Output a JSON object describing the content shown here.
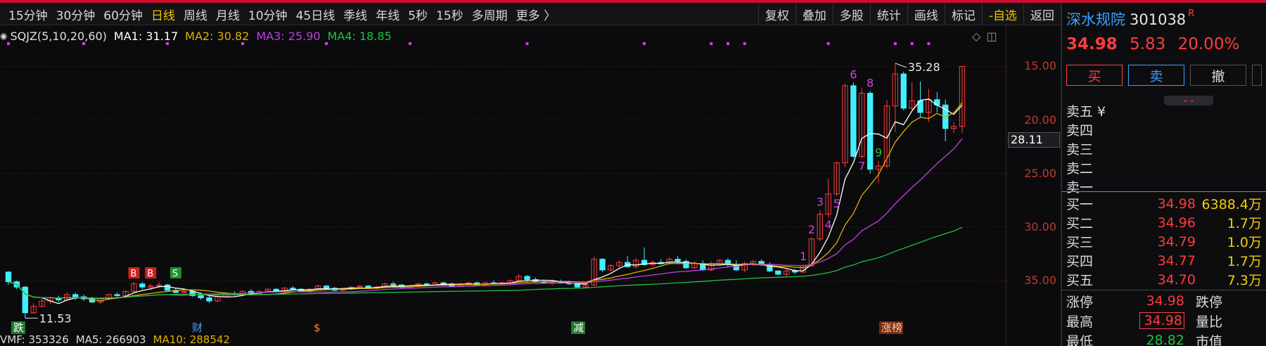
{
  "toolbar": {
    "periods": [
      {
        "label": "15分钟",
        "active": false
      },
      {
        "label": "30分钟",
        "active": false
      },
      {
        "label": "60分钟",
        "active": false
      },
      {
        "label": "日线",
        "active": true
      },
      {
        "label": "周线",
        "active": false
      },
      {
        "label": "月线",
        "active": false
      },
      {
        "label": "10分钟",
        "active": false
      },
      {
        "label": "45日线",
        "active": false
      },
      {
        "label": "季线",
        "active": false
      },
      {
        "label": "年线",
        "active": false
      },
      {
        "label": "5秒",
        "active": false
      },
      {
        "label": "15秒",
        "active": false
      },
      {
        "label": "多周期",
        "active": false
      },
      {
        "label": "更多 〉",
        "active": false
      }
    ],
    "actions": [
      {
        "label": "复权",
        "highlight": false
      },
      {
        "label": "叠加",
        "highlight": false
      },
      {
        "label": "多股",
        "highlight": false
      },
      {
        "label": "统计",
        "highlight": false
      },
      {
        "label": "画线",
        "highlight": false
      },
      {
        "label": "标记",
        "highlight": false
      },
      {
        "label": "-自选",
        "highlight": true
      },
      {
        "label": "返回",
        "highlight": false
      }
    ]
  },
  "legend": {
    "indicator": "SQJZ(5,10,20,60)",
    "ma1": "MA1: 31.17",
    "ma2": "MA2: 30.82",
    "ma3": "MA3: 25.90",
    "ma4": "MA4: 18.85"
  },
  "colors": {
    "up": "#ff3b3b",
    "down": "#3ff0ff",
    "ma1": "#ffffff",
    "ma2": "#e0b000",
    "ma3": "#c040e0",
    "ma4": "#20c040"
  },
  "axis": {
    "ticks": [
      "35.00",
      "30.00",
      "25.00",
      "20.00",
      "15.00"
    ],
    "current": "28.11"
  },
  "chart_data": {
    "type": "candlestick",
    "ylim": [
      11,
      37
    ],
    "y_ticks": [
      15,
      20,
      25,
      30,
      35
    ],
    "annotations": {
      "high_label": "35.28",
      "low_label": "11.53",
      "counts": [
        "1",
        "2",
        "3",
        "4",
        "5",
        "6",
        "7",
        "8",
        "9"
      ],
      "signals": [
        "B",
        "B",
        "S"
      ],
      "events": [
        "跌",
        "财",
        "$",
        "减",
        "涨榜"
      ]
    },
    "ohlc": [
      [
        15.8,
        15.9,
        14.6,
        14.9
      ],
      [
        14.9,
        15.0,
        14.2,
        14.4
      ],
      [
        14.4,
        14.5,
        11.5,
        12.0
      ],
      [
        12.0,
        12.9,
        11.9,
        12.6
      ],
      [
        12.6,
        13.3,
        12.5,
        13.1
      ],
      [
        13.1,
        13.5,
        12.8,
        13.4
      ],
      [
        13.4,
        13.6,
        13.0,
        13.2
      ],
      [
        13.2,
        13.9,
        13.1,
        13.7
      ],
      [
        13.7,
        13.9,
        13.2,
        13.5
      ],
      [
        13.5,
        13.7,
        13.1,
        13.3
      ],
      [
        13.3,
        13.5,
        12.9,
        13.0
      ],
      [
        13.0,
        13.4,
        12.8,
        13.3
      ],
      [
        13.3,
        13.8,
        13.2,
        13.7
      ],
      [
        13.7,
        13.9,
        13.4,
        13.6
      ],
      [
        13.6,
        14.1,
        13.5,
        14.0
      ],
      [
        14.0,
        14.9,
        13.9,
        14.7
      ],
      [
        14.7,
        14.9,
        14.2,
        14.4
      ],
      [
        14.4,
        14.7,
        14.1,
        14.5
      ],
      [
        14.5,
        14.9,
        14.3,
        14.6
      ],
      [
        14.6,
        14.7,
        14.0,
        14.1
      ],
      [
        14.1,
        14.3,
        13.8,
        13.9
      ],
      [
        13.9,
        14.2,
        13.7,
        14.0
      ],
      [
        14.0,
        14.1,
        13.5,
        13.6
      ],
      [
        13.6,
        13.9,
        13.2,
        13.4
      ],
      [
        13.4,
        13.6,
        12.9,
        13.1
      ],
      [
        13.1,
        13.6,
        13.0,
        13.5
      ],
      [
        13.5,
        13.9,
        13.4,
        13.8
      ],
      [
        13.8,
        14.0,
        13.6,
        13.7
      ],
      [
        13.7,
        14.1,
        13.6,
        14.0
      ],
      [
        14.0,
        14.2,
        13.7,
        13.8
      ],
      [
        13.8,
        14.1,
        13.7,
        14.0
      ],
      [
        14.0,
        14.3,
        13.9,
        14.2
      ],
      [
        14.2,
        14.3,
        13.9,
        14.0
      ],
      [
        14.0,
        14.4,
        13.9,
        14.3
      ],
      [
        14.3,
        14.5,
        14.1,
        14.2
      ],
      [
        14.2,
        14.3,
        13.9,
        14.0
      ],
      [
        14.0,
        14.3,
        13.9,
        14.2
      ],
      [
        14.2,
        14.6,
        14.1,
        14.5
      ],
      [
        14.5,
        14.6,
        14.2,
        14.3
      ],
      [
        14.3,
        14.4,
        14.0,
        14.1
      ],
      [
        14.1,
        14.3,
        14.0,
        14.2
      ],
      [
        14.2,
        14.5,
        14.1,
        14.4
      ],
      [
        14.4,
        14.6,
        14.3,
        14.5
      ],
      [
        14.5,
        14.6,
        14.2,
        14.3
      ],
      [
        14.3,
        14.5,
        14.2,
        14.4
      ],
      [
        14.4,
        14.8,
        14.3,
        14.7
      ],
      [
        14.7,
        14.9,
        14.5,
        14.6
      ],
      [
        14.6,
        14.7,
        14.3,
        14.4
      ],
      [
        14.4,
        14.6,
        14.3,
        14.5
      ],
      [
        14.5,
        14.8,
        14.4,
        14.7
      ],
      [
        14.7,
        14.8,
        14.5,
        14.6
      ],
      [
        14.6,
        14.9,
        14.5,
        14.8
      ],
      [
        14.8,
        14.9,
        14.6,
        14.7
      ],
      [
        14.7,
        14.8,
        14.4,
        14.5
      ],
      [
        14.5,
        14.8,
        14.4,
        14.7
      ],
      [
        14.7,
        14.9,
        14.6,
        14.8
      ],
      [
        14.8,
        14.9,
        14.5,
        14.6
      ],
      [
        14.6,
        14.9,
        14.5,
        14.8
      ],
      [
        14.8,
        15.0,
        14.6,
        14.7
      ],
      [
        14.7,
        14.9,
        14.6,
        14.8
      ],
      [
        14.8,
        15.1,
        14.7,
        15.0
      ],
      [
        15.0,
        15.6,
        14.9,
        15.4
      ],
      [
        15.4,
        15.5,
        14.9,
        15.1
      ],
      [
        15.1,
        15.3,
        14.8,
        14.9
      ],
      [
        14.9,
        15.1,
        14.7,
        14.8
      ],
      [
        14.8,
        15.0,
        14.6,
        14.9
      ],
      [
        14.9,
        15.1,
        14.7,
        14.8
      ],
      [
        14.8,
        15.0,
        14.6,
        14.7
      ],
      [
        14.7,
        14.9,
        14.3,
        14.4
      ],
      [
        14.4,
        14.8,
        14.3,
        14.6
      ],
      [
        14.6,
        17.2,
        14.5,
        17.0
      ],
      [
        17.0,
        17.1,
        15.8,
        16.0
      ],
      [
        16.0,
        16.6,
        15.9,
        16.4
      ],
      [
        16.4,
        16.9,
        16.2,
        16.7
      ],
      [
        16.7,
        17.3,
        16.2,
        16.3
      ],
      [
        16.3,
        17.1,
        16.1,
        16.9
      ],
      [
        16.9,
        18.1,
        16.4,
        16.5
      ],
      [
        16.5,
        16.9,
        16.3,
        16.7
      ],
      [
        16.7,
        17.0,
        16.5,
        16.6
      ],
      [
        16.6,
        17.2,
        16.5,
        17.0
      ],
      [
        17.0,
        17.3,
        16.6,
        16.8
      ],
      [
        16.8,
        17.0,
        16.1,
        16.2
      ],
      [
        16.2,
        16.8,
        16.1,
        16.6
      ],
      [
        16.6,
        16.9,
        15.9,
        16.0
      ],
      [
        16.0,
        16.8,
        15.9,
        16.6
      ],
      [
        16.6,
        17.0,
        16.4,
        16.9
      ],
      [
        16.9,
        17.1,
        16.3,
        16.5
      ],
      [
        16.5,
        16.9,
        15.9,
        16.0
      ],
      [
        16.0,
        16.8,
        15.8,
        16.6
      ],
      [
        16.6,
        16.9,
        16.4,
        16.8
      ],
      [
        16.8,
        17.0,
        16.4,
        16.5
      ],
      [
        16.5,
        16.7,
        15.8,
        15.9
      ],
      [
        15.9,
        16.0,
        15.5,
        15.6
      ],
      [
        15.6,
        16.1,
        15.4,
        15.9
      ],
      [
        15.9,
        16.1,
        15.6,
        15.8
      ],
      [
        15.8,
        16.5,
        15.7,
        16.4
      ],
      [
        16.4,
        19.0,
        16.3,
        18.9
      ],
      [
        18.9,
        21.6,
        18.7,
        21.2
      ],
      [
        21.2,
        24.5,
        20.9,
        23.1
      ],
      [
        23.1,
        26.1,
        22.9,
        26.0
      ],
      [
        26.0,
        33.4,
        25.6,
        33.2
      ],
      [
        33.2,
        33.5,
        26.5,
        26.6
      ],
      [
        26.6,
        33.0,
        26.4,
        32.5
      ],
      [
        32.5,
        32.7,
        25.0,
        25.4
      ],
      [
        25.4,
        26.2,
        24.1,
        25.7
      ],
      [
        25.7,
        31.9,
        25.5,
        31.3
      ],
      [
        31.3,
        35.3,
        28.9,
        34.3
      ],
      [
        34.3,
        34.5,
        30.9,
        31.1
      ],
      [
        31.1,
        33.5,
        30.9,
        31.8
      ],
      [
        31.8,
        33.6,
        30.2,
        30.7
      ],
      [
        30.7,
        32.9,
        29.8,
        31.9
      ],
      [
        31.9,
        32.6,
        30.7,
        31.4
      ],
      [
        31.4,
        31.9,
        28.0,
        29.2
      ],
      [
        29.2,
        29.8,
        28.8,
        29.4
      ],
      [
        29.4,
        35.0,
        28.8,
        35.0
      ]
    ]
  },
  "stock": {
    "name": "深水规院",
    "code": "301038",
    "tag": "R",
    "price": "34.98",
    "change": "5.83",
    "pct": "20.00%"
  },
  "buttons": {
    "buy": "买",
    "sell": "卖",
    "cancel": "撤"
  },
  "orderbook": {
    "asks": [
      {
        "label": "卖五 ¥",
        "price": "",
        "vol": ""
      },
      {
        "label": "卖四",
        "price": "",
        "vol": ""
      },
      {
        "label": "卖三",
        "price": "",
        "vol": ""
      },
      {
        "label": "卖二",
        "price": "",
        "vol": ""
      },
      {
        "label": "卖一",
        "price": "",
        "vol": ""
      }
    ],
    "bids": [
      {
        "label": "买一",
        "price": "34.98",
        "vol": "6388.4万"
      },
      {
        "label": "买二",
        "price": "34.96",
        "vol": "1.7万"
      },
      {
        "label": "买三",
        "price": "34.79",
        "vol": "1.0万"
      },
      {
        "label": "买四",
        "price": "34.77",
        "vol": "1.7万"
      },
      {
        "label": "买五",
        "price": "34.70",
        "vol": "7.3万"
      }
    ]
  },
  "stats": [
    {
      "l1": "涨停",
      "v1": "34.98",
      "l2": "跌停"
    },
    {
      "l1": "最高",
      "v1": "34.98",
      "l2": "量比"
    },
    {
      "l1": "最低",
      "v1": "28.82",
      "l2": "市值"
    }
  ],
  "bottom_ma": {
    "vma": "VMF: 353326",
    "ma5": "MA5: 266903",
    "ma10": "MA10: 288542"
  }
}
